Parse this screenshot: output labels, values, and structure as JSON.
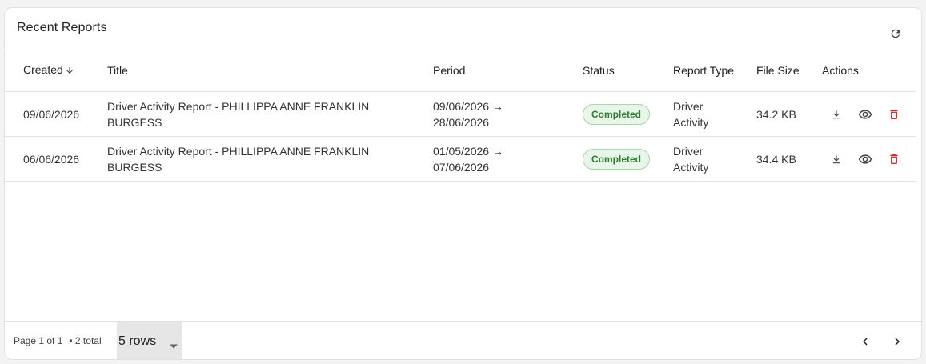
{
  "card": {
    "title": "Recent Reports"
  },
  "table": {
    "headers": {
      "created": "Created",
      "title": "Title",
      "period": "Period",
      "status": "Status",
      "report_type": "Report Type",
      "file_size": "File Size",
      "actions": "Actions"
    },
    "rows": [
      {
        "created": "09/06/2026",
        "title_line1": "Driver Activity Report - PHILLIPPA ANNE FRANKLIN",
        "title_line2": "BURGESS",
        "period_line1": "09/06/2026 →",
        "period_line2": "28/06/2026",
        "status": "Completed",
        "type_line1": "Driver",
        "type_line2": "Activity",
        "file_size": "34.2 KB"
      },
      {
        "created": "06/06/2026",
        "title_line1": "Driver Activity Report - PHILLIPPA ANNE FRANKLIN",
        "title_line2": "BURGESS",
        "period_line1": "01/05/2026 →",
        "period_line2": "07/06/2026",
        "status": "Completed",
        "type_line1": "Driver",
        "type_line2": "Activity",
        "file_size": "34.4 KB"
      }
    ]
  },
  "footer": {
    "page_info": "Page 1 of 1",
    "total": "• 2 total",
    "rows_per_page": "5 rows"
  },
  "icons": {
    "refresh": "refresh-icon",
    "sort": "arrow-down-icon",
    "download": "download-icon",
    "view": "eye-icon",
    "delete": "trash-icon",
    "dropdown": "caret-down-icon",
    "prev": "chevron-left-icon",
    "next": "chevron-right-icon"
  },
  "colors": {
    "status_text": "#2e7d32",
    "status_bg": "#e8f5e9",
    "delete": "#d32f2f"
  }
}
